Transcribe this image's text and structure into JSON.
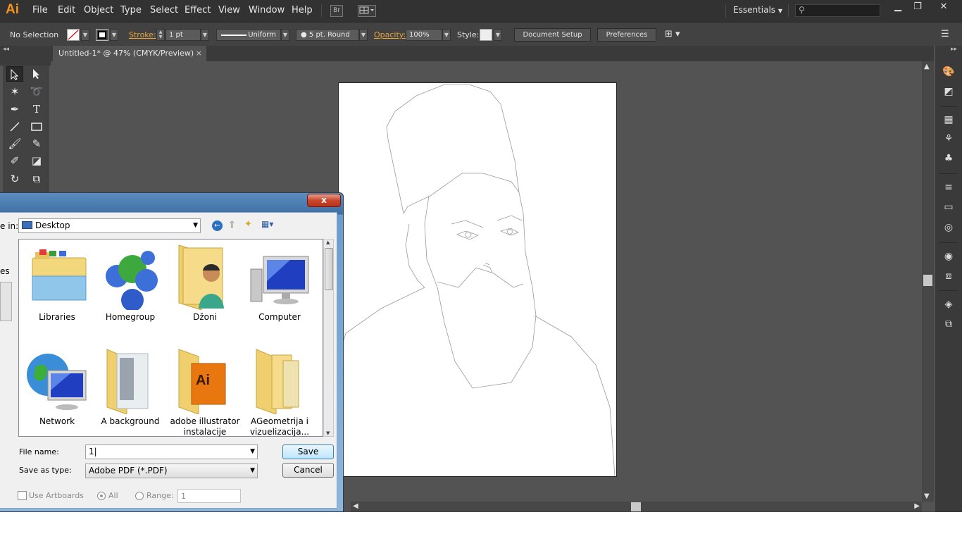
{
  "app": {
    "logo": "Ai"
  },
  "menu": [
    "File",
    "Edit",
    "Object",
    "Type",
    "Select",
    "Effect",
    "View",
    "Window",
    "Help"
  ],
  "bridge_button": "Br",
  "workspace": {
    "label": "Essentials"
  },
  "window_controls": {
    "minimize": "▁",
    "restore": "❐",
    "close": "✕"
  },
  "control_bar": {
    "selection": "No Selection",
    "stroke_label": "Stroke:",
    "stroke_weight": "1 pt",
    "profile": "Uniform",
    "brush": "5 pt. Round",
    "opacity_label": "Opacity:",
    "opacity": "100%",
    "style_label": "Style:",
    "document_setup": "Document Setup",
    "preferences": "Preferences"
  },
  "document_tab": {
    "title": "Untitled-1* @ 47% (CMYK/Preview)",
    "close": "×"
  },
  "save_dialog": {
    "close": "x",
    "save_in_label": "e in:",
    "save_in_value": "Desktop",
    "left_label_partial": "es",
    "items": [
      {
        "label": "Libraries",
        "icon": "libraries-icon"
      },
      {
        "label": "Homegroup",
        "icon": "homegroup-icon"
      },
      {
        "label": "Džoni",
        "icon": "user-folder-icon"
      },
      {
        "label": "Computer",
        "icon": "computer-icon"
      },
      {
        "label": "Network",
        "icon": "network-icon"
      },
      {
        "label": "A background",
        "icon": "folder-icon"
      },
      {
        "label": "adobe illustrator instalacije",
        "icon": "folder-icon"
      },
      {
        "label": "AGeometrija i vizuelizacija...",
        "icon": "folder-icon"
      }
    ],
    "file_name_label": "File name:",
    "file_name_value": "1",
    "save_as_type_label": "Save as type:",
    "save_as_type_value": "Adobe PDF (*.PDF)",
    "save_button": "Save",
    "cancel_button": "Cancel",
    "use_artboards": "Use Artboards",
    "all": "All",
    "range": "Range:",
    "range_value": "1"
  },
  "colors": {
    "accent_orange": "#f7941d",
    "ui_dark": "#323232",
    "ui_mid": "#535353"
  }
}
